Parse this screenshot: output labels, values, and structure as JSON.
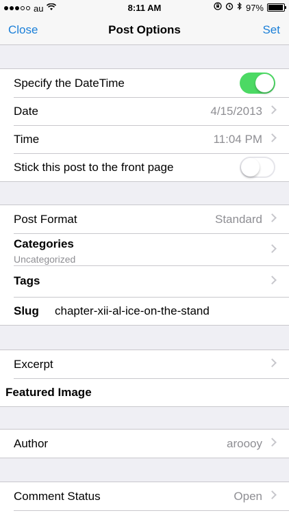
{
  "status_bar": {
    "carrier": "au",
    "signal_bars": 5,
    "signal_filled": 3,
    "time": "8:11 AM",
    "battery": "97%",
    "battery_level": 0.97,
    "icons": [
      "wifi-icon",
      "orientation-lock-icon",
      "alarm-icon",
      "bluetooth-icon"
    ]
  },
  "navbar": {
    "left": "Close",
    "title": "Post Options",
    "right": "Set"
  },
  "colors": {
    "accent": "#1a7fd8",
    "toggle_on": "#4cd964",
    "background": "#efeff4",
    "secondary_text": "#8e8e93"
  },
  "section1": {
    "specify_datetime": {
      "label": "Specify the DateTime",
      "on": true
    },
    "date": {
      "label": "Date",
      "value": "4/15/2013"
    },
    "time": {
      "label": "Time",
      "value": "11:04 PM"
    },
    "sticky": {
      "label": "Stick this post to the front page",
      "on": false
    }
  },
  "section2": {
    "post_format": {
      "label": "Post Format",
      "value": "Standard"
    },
    "categories": {
      "label": "Categories",
      "sub": "Uncategorized"
    },
    "tags": {
      "label": "Tags"
    },
    "slug": {
      "label": "Slug",
      "value": "chapter-xii-al-ice-on-the-stand"
    }
  },
  "section3": {
    "excerpt": {
      "label": "Excerpt"
    },
    "featured_image": {
      "label": "Featured Image"
    }
  },
  "section4": {
    "author": {
      "label": "Author",
      "value": "aroooy"
    }
  },
  "section5": {
    "comment_status": {
      "label": "Comment Status",
      "value": "Open"
    }
  }
}
